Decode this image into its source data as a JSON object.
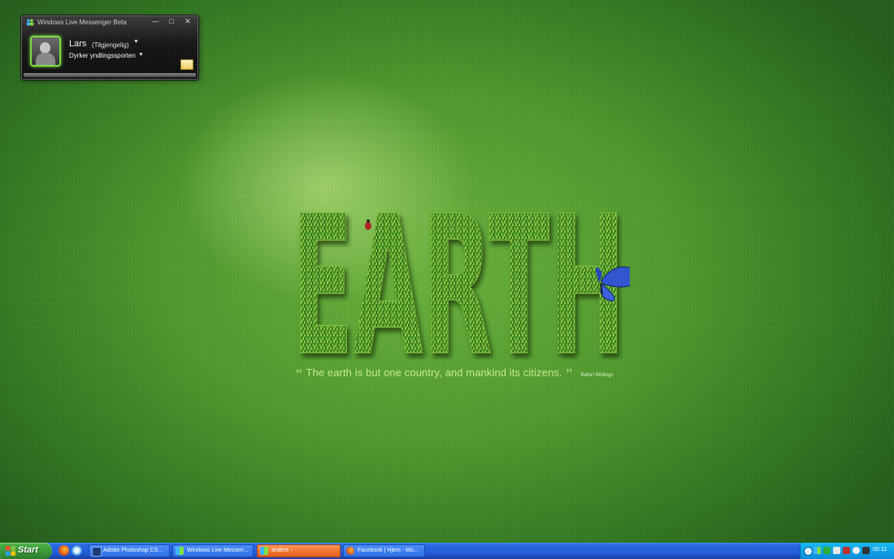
{
  "messenger": {
    "title": "Windows Live Messenger Beta",
    "window_buttons": {
      "minimize": "—",
      "maximize": "□",
      "close": "✕"
    },
    "user_name": "Lars",
    "status": "(Tilgjengelig)",
    "personal_message": "Dyrker yndlingssporten",
    "icons": {
      "title": "messenger-people-icon",
      "mail": "mail-icon",
      "dropdown": "chevron-down-icon"
    }
  },
  "wallpaper": {
    "word": "EARTH",
    "quote_open": "“",
    "quote": "The earth is but one country, and mankind its citizens.",
    "quote_close": "”",
    "attribution": "Baha'i Writings"
  },
  "taskbar": {
    "start_label": "Start",
    "quick_launch": [
      "firefox-icon",
      "internet-explorer-icon"
    ],
    "tasks": [
      {
        "label": "Adobe Photoshop CS...",
        "icon": "photoshop-icon",
        "active": false
      },
      {
        "label": "Windows Live Messen...",
        "icon": "messenger-icon",
        "active": false
      },
      {
        "label": "anders -",
        "icon": "messenger-chat-icon",
        "active": true
      },
      {
        "label": "Facebook | Hjem - Mo...",
        "icon": "firefox-icon",
        "active": false
      }
    ],
    "clock": "00:11"
  },
  "colors": {
    "desktop_green": "#4f9a2d",
    "taskbar_blue": "#245edb",
    "start_green": "#3c9a3a",
    "active_task_orange": "#f07632",
    "tray_blue": "#0fa3e8"
  }
}
